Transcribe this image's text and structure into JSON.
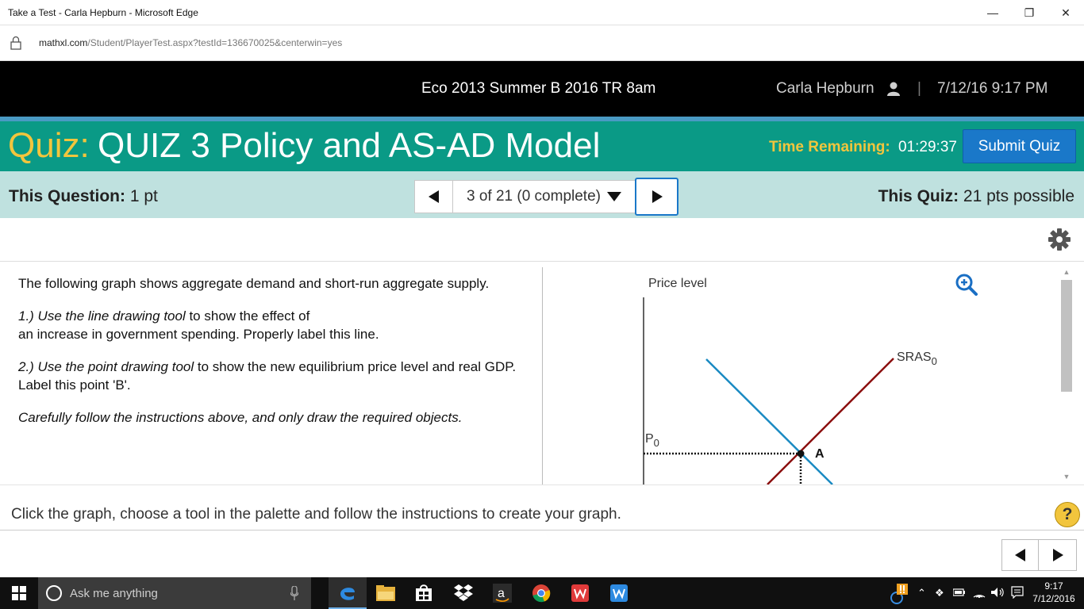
{
  "window": {
    "title": "Take a Test - Carla Hepburn - Microsoft Edge",
    "minimize": "—",
    "restore": "❐",
    "close": "✕"
  },
  "address": {
    "host": "mathxl.com",
    "path": "/Student/PlayerTest.aspx?testId=136670025&centerwin=yes"
  },
  "header": {
    "course": "Eco 2013 Summer B 2016 TR 8am",
    "user": "Carla Hepburn",
    "separator": "|",
    "datetime": "7/12/16 9:17 PM"
  },
  "quiz": {
    "prefix": "Quiz:",
    "name": "QUIZ 3 Policy and AS-AD Model",
    "time_label": "Time Remaining:",
    "time_value": "01:29:37",
    "submit_label": "Submit Quiz"
  },
  "question_bar": {
    "this_question_label": "This Question:",
    "this_question_value": "1 pt",
    "selector": "3 of 21 (0 complete)",
    "this_quiz_label": "This Quiz:",
    "this_quiz_value": "21 pts possible"
  },
  "question": {
    "intro": "The following graph shows aggregate demand and short-run aggregate supply.",
    "step1_italic": "1.) Use the line drawing tool",
    "step1_rest_a": " to show the effect of",
    "step1_rest_b": "an increase in government spending. Properly label this line.",
    "step2_italic": "2.) Use the point drawing tool",
    "step2_rest": " to show the new equilibrium price level and real GDP. Label this point 'B'.",
    "note": "Carefully follow the instructions above, and only draw the required objects."
  },
  "graph": {
    "y_axis_label": "Price level",
    "sras_label": "SRAS",
    "sras_sub": "0",
    "p_label": "P",
    "p_sub": "0",
    "point_label": "A",
    "colors": {
      "ad": "#1a8ac2",
      "sras": "#8b0e0e"
    }
  },
  "footer": {
    "instruction": "Click the graph, choose a tool in the palette and follow the instructions to create your graph.",
    "help": "?"
  },
  "taskbar": {
    "search_placeholder": "Ask me anything",
    "apps": [
      "edge-icon",
      "file-explorer-icon",
      "store-icon",
      "dropbox-icon",
      "amazon-icon",
      "chrome-icon",
      "wps-icon",
      "wps-writer-icon"
    ],
    "time": "9:17",
    "date": "7/12/2016"
  }
}
